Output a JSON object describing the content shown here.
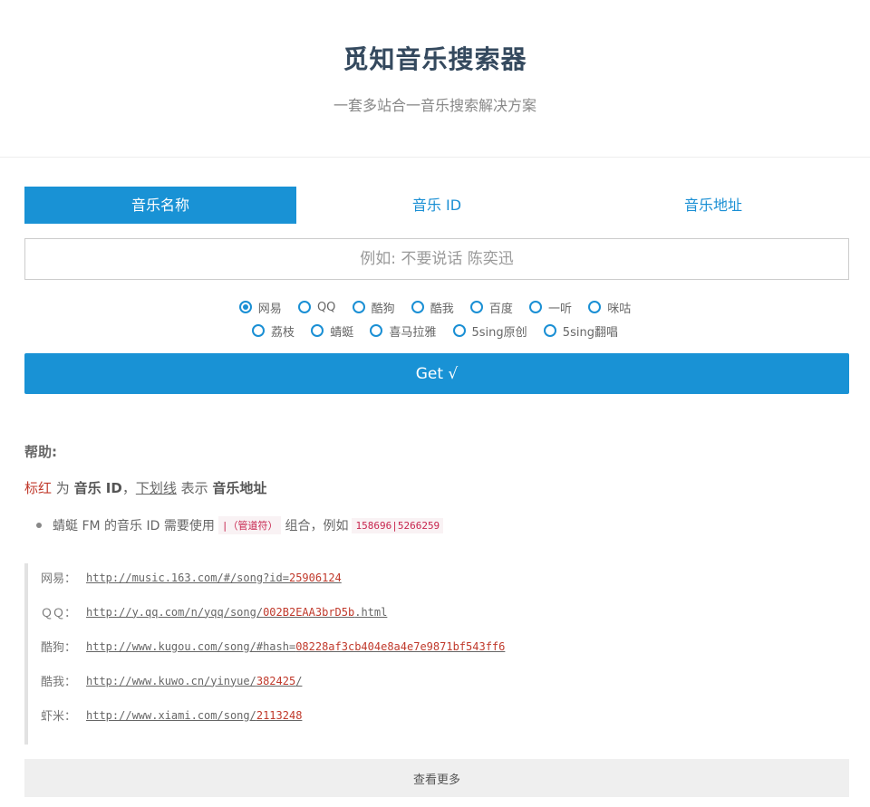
{
  "header": {
    "title": "觅知音乐搜索器",
    "subtitle": "一套多站合一音乐搜索解决方案"
  },
  "tabs": [
    {
      "label": "音乐名称",
      "active": true
    },
    {
      "label": "音乐 ID",
      "active": false
    },
    {
      "label": "音乐地址",
      "active": false
    }
  ],
  "search": {
    "placeholder": "例如: 不要说话 陈奕迅",
    "value": ""
  },
  "sources_row1": [
    {
      "label": "网易",
      "checked": true
    },
    {
      "label": "QQ",
      "checked": false
    },
    {
      "label": "酷狗",
      "checked": false
    },
    {
      "label": "酷我",
      "checked": false
    },
    {
      "label": "百度",
      "checked": false
    },
    {
      "label": "一听",
      "checked": false
    },
    {
      "label": "咪咕",
      "checked": false
    }
  ],
  "sources_row2": [
    {
      "label": "荔枝",
      "checked": false
    },
    {
      "label": "蜻蜓",
      "checked": false
    },
    {
      "label": "喜马拉雅",
      "checked": false
    },
    {
      "label": "5sing原创",
      "checked": false
    },
    {
      "label": "5sing翻唱",
      "checked": false
    }
  ],
  "get_button": "Get √",
  "help": {
    "title": "帮助:",
    "legend": {
      "red": "标红",
      "is": " 为 ",
      "music_id": "音乐 ID",
      "comma": "，",
      "underline": "下划线",
      "means": " 表示 ",
      "music_url": "音乐地址"
    },
    "bullet": {
      "text1": "蜻蜓 FM 的音乐 ID 需要使用",
      "code1": "|（管道符）",
      "text2": "组合，例如",
      "code2": "158696|5266259"
    }
  },
  "examples": [
    {
      "label": "网易：",
      "prefix": "http://music.163.com/#/song?id=",
      "id": "25906124",
      "suffix": ""
    },
    {
      "label": "ＱＱ：",
      "prefix": "http://y.qq.com/n/yqq/song/",
      "id": "002B2EAA3brD5b",
      "suffix": ".html"
    },
    {
      "label": "酷狗：",
      "prefix": "http://www.kugou.com/song/#hash=",
      "id": "08228af3cb404e8a4e7e9871bf543ff6",
      "suffix": ""
    },
    {
      "label": "酷我：",
      "prefix": "http://www.kuwo.cn/yinyue/",
      "id": "382425",
      "suffix": "/"
    },
    {
      "label": "虾米：",
      "prefix": "http://www.xiami.com/song/",
      "id": "2113248",
      "suffix": ""
    }
  ],
  "more_button": "查看更多",
  "colors": {
    "accent": "#1992d5",
    "highlight": "#c0392b"
  }
}
